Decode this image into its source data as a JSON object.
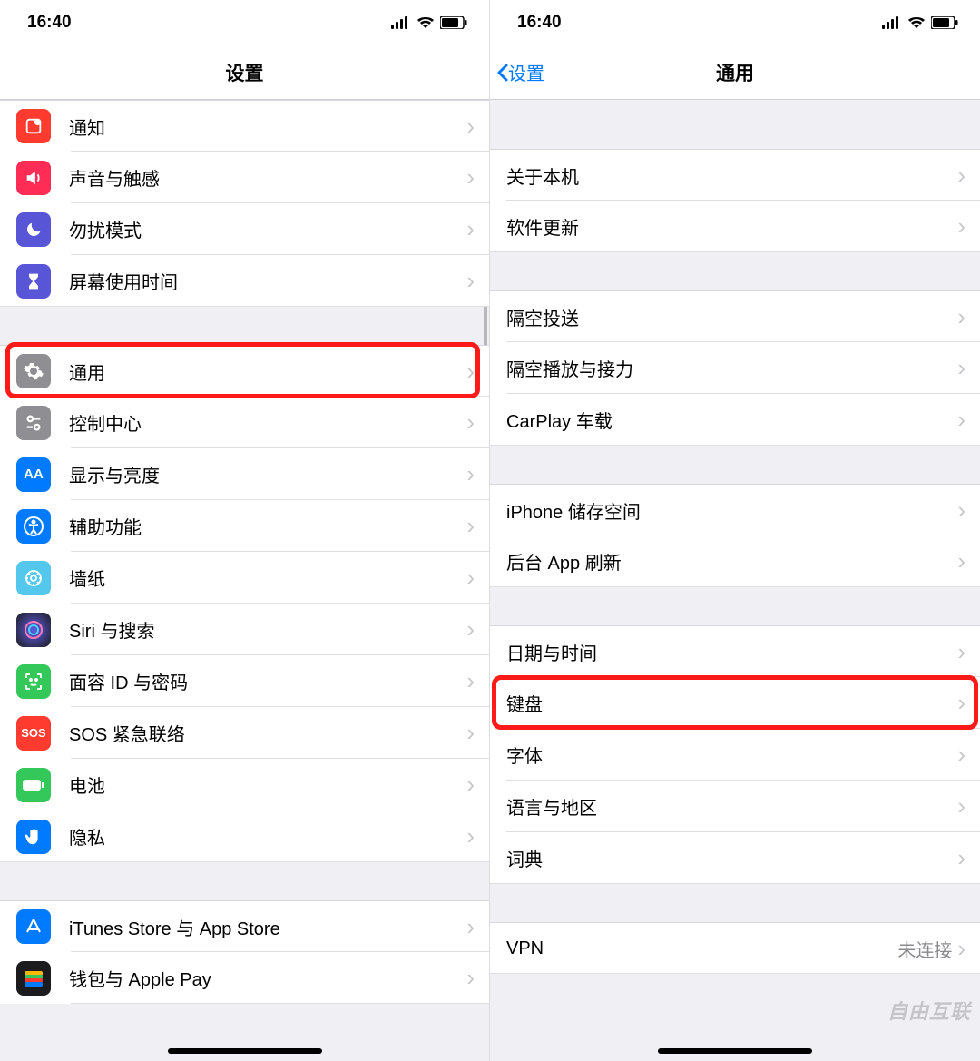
{
  "left": {
    "status": {
      "time": "16:40"
    },
    "nav": {
      "title": "设置"
    },
    "sections": [
      {
        "items": [
          {
            "label": "通知",
            "iconBg": "#ff3b30",
            "icon": "notify"
          },
          {
            "label": "声音与触感",
            "iconBg": "#ff2d55",
            "icon": "sound"
          },
          {
            "label": "勿扰模式",
            "iconBg": "#5856d6",
            "icon": "moon"
          },
          {
            "label": "屏幕使用时间",
            "iconBg": "#5856d6",
            "icon": "hourglass"
          }
        ]
      },
      {
        "items": [
          {
            "label": "通用",
            "iconBg": "#8e8e93",
            "icon": "gear",
            "highlight": true
          },
          {
            "label": "控制中心",
            "iconBg": "#8e8e93",
            "icon": "switches"
          },
          {
            "label": "显示与亮度",
            "iconBg": "#007aff",
            "icon": "aa"
          },
          {
            "label": "辅助功能",
            "iconBg": "#007aff",
            "icon": "access"
          },
          {
            "label": "墙纸",
            "iconBg": "#54c7ec",
            "icon": "wallpaper"
          },
          {
            "label": "Siri 与搜索",
            "iconBg": "#1c1c1e",
            "icon": "siri"
          },
          {
            "label": "面容 ID 与密码",
            "iconBg": "#34c759",
            "icon": "faceid"
          },
          {
            "label": "SOS 紧急联络",
            "iconBg": "#ff3b30",
            "icon": "sos"
          },
          {
            "label": "电池",
            "iconBg": "#34c759",
            "icon": "battery"
          },
          {
            "label": "隐私",
            "iconBg": "#007aff",
            "icon": "hand"
          }
        ]
      },
      {
        "items": [
          {
            "label": "iTunes Store 与 App Store",
            "iconBg": "#007aff",
            "icon": "appstore"
          },
          {
            "label": "钱包与 Apple Pay",
            "iconBg": "#1c1c1e",
            "icon": "wallet"
          }
        ]
      }
    ]
  },
  "right": {
    "status": {
      "time": "16:40"
    },
    "nav": {
      "back": "设置",
      "title": "通用"
    },
    "sections": [
      {
        "gap": "large",
        "items": [
          {
            "label": "关于本机"
          },
          {
            "label": "软件更新"
          }
        ]
      },
      {
        "items": [
          {
            "label": "隔空投送"
          },
          {
            "label": "隔空播放与接力"
          },
          {
            "label": "CarPlay 车载"
          }
        ]
      },
      {
        "items": [
          {
            "label": "iPhone 储存空间"
          },
          {
            "label": "后台 App 刷新"
          }
        ]
      },
      {
        "items": [
          {
            "label": "日期与时间"
          },
          {
            "label": "键盘",
            "highlight": true
          },
          {
            "label": "字体"
          },
          {
            "label": "语言与地区"
          },
          {
            "label": "词典"
          }
        ]
      },
      {
        "items": [
          {
            "label": "VPN",
            "value": "未连接"
          }
        ]
      }
    ]
  },
  "watermark": "自由互联"
}
